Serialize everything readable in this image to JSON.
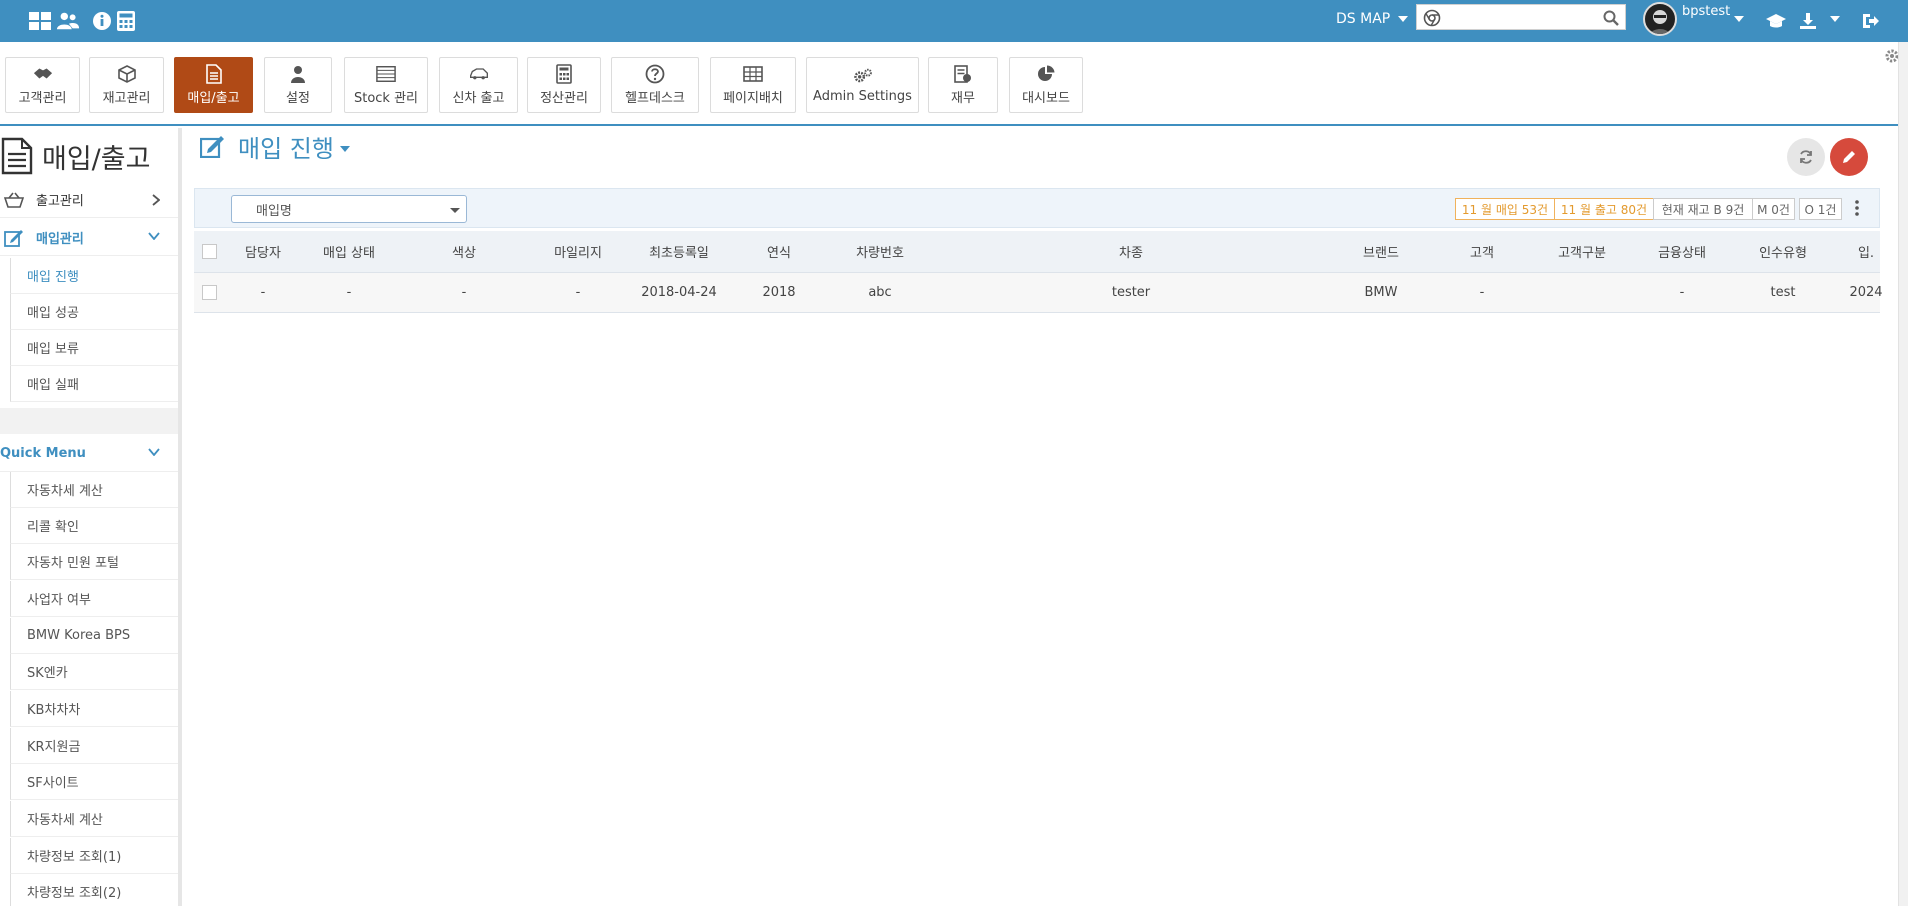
{
  "topbar": {
    "ds_map_label": "DS MAP",
    "search_value": "",
    "username": "bpstest"
  },
  "modules": [
    {
      "label": "고객관리",
      "icon": "handshake-icon"
    },
    {
      "label": "재고관리",
      "icon": "box-icon"
    },
    {
      "label": "매입/출고",
      "icon": "document-icon",
      "active": true
    },
    {
      "label": "설정",
      "icon": "user-icon"
    },
    {
      "label": "Stock 관리",
      "icon": "building-icon"
    },
    {
      "label": "신차 출고",
      "icon": "car-icon"
    },
    {
      "label": "정산관리",
      "icon": "calculator-icon"
    },
    {
      "label": "헬프데스크",
      "icon": "help-icon"
    },
    {
      "label": "페이지배치",
      "icon": "grid-icon"
    },
    {
      "label": "Admin Settings",
      "icon": "gears-icon"
    },
    {
      "label": "재무",
      "icon": "finance-icon"
    },
    {
      "label": "대시보드",
      "icon": "pie-chart-icon"
    }
  ],
  "sidebar": {
    "title": "매입/출고",
    "sections": [
      {
        "label": "출고관리"
      },
      {
        "label": "매입관리"
      }
    ],
    "purchase_items": [
      "매입 진행",
      "매입 성공",
      "매입 보류",
      "매입 실패"
    ],
    "quick_menu_label": "Quick Menu",
    "quick_items": [
      "자동차세 계산",
      "리콜 확인",
      "자동차 민원 포털",
      "사업자 여부",
      "BMW Korea BPS",
      "SK엔카",
      "KB차차차",
      "KR지원금",
      "SF사이트",
      "자동차세 계산",
      "차량정보 조회(1)",
      "차량정보 조회(2)"
    ]
  },
  "main": {
    "heading": "매입 진행",
    "select_value": "매입명",
    "badges": [
      "11 월 매입 53건",
      "11 월 출고 80건",
      "현재 재고 B 9건",
      "M 0건",
      "O 1건"
    ],
    "columns": [
      "담당자",
      "매입 상태",
      "색상",
      "마일리지",
      "최초등록일",
      "연식",
      "차량번호",
      "차종",
      "브랜드",
      "고객",
      "고객구분",
      "금융상태",
      "인수유형",
      "입."
    ],
    "rows": [
      [
        "-",
        "-",
        "-",
        "-",
        "2018-04-24",
        "2018",
        "abc",
        "tester",
        "BMW",
        "-",
        "",
        "-",
        "test",
        "2024"
      ]
    ]
  }
}
